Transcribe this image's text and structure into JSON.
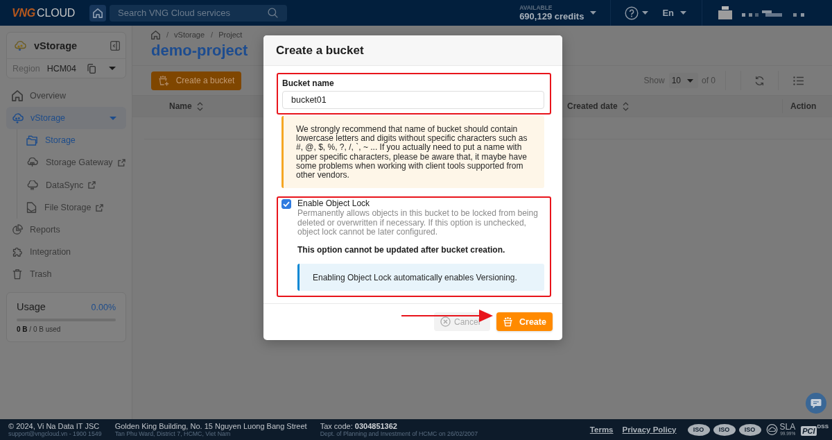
{
  "top_bar": {
    "logo": {
      "brand": "VNG",
      "product": "CLOUD"
    },
    "search": {
      "placeholder": "Search VNG Cloud services"
    },
    "credits": {
      "label": "AVAILABLE",
      "value": "690,129 credits"
    },
    "language": "En"
  },
  "sidebar": {
    "service": {
      "title": "vStorage"
    },
    "region": {
      "label": "Region",
      "value": "HCM04"
    },
    "items": [
      {
        "label": "Overview",
        "selected": false,
        "expanded": false
      },
      {
        "label": "vStorage",
        "selected": true,
        "expanded": true,
        "children": [
          {
            "label": "Storage",
            "selected": true,
            "external": false
          },
          {
            "label": "Storage Gateway",
            "selected": false,
            "external": true
          },
          {
            "label": "DataSync",
            "selected": false,
            "external": true
          },
          {
            "label": "File Storage",
            "selected": false,
            "external": true
          }
        ]
      },
      {
        "label": "Reports",
        "selected": false,
        "expanded": false
      },
      {
        "label": "Integration",
        "selected": false,
        "expanded": false
      },
      {
        "label": "Trash",
        "selected": false,
        "expanded": false
      }
    ],
    "usage": {
      "title": "Usage",
      "percent": "0.00%",
      "level": 0,
      "detail": "**0 B** / 0 B used"
    }
  },
  "page": {
    "breadcrumb": [
      "vStorage",
      "Project"
    ],
    "separator": "/",
    "title": "demo-project"
  },
  "toolbar": {
    "create_button": "Create a bucket",
    "show_label": "Show",
    "page_size": "10",
    "total": "of 0"
  },
  "table": {
    "columns": [
      {
        "label": "Name",
        "sortable": true
      },
      {
        "label": "Created date",
        "sortable": true
      },
      {
        "label": "Action",
        "sortable": false
      }
    ]
  },
  "dialog": {
    "title": "Create a bucket",
    "bucket_name": {
      "label": "Bucket name",
      "value": "bucket01",
      "highlighted": true
    },
    "warning": "We strongly recommend that name of bucket should contain lowercase letters and digits without specific characters such as #, @, $, %, ?, /, `, ~ ... If you actually need to put a name with upper specific characters, please be aware that, it maybe have some problems when working with client tools supported from other vendors.",
    "object_lock": {
      "label": "Enable Object Lock",
      "checked": true,
      "highlighted": true,
      "description": "Permanently allows objects in this bucket to be locked from being deleted or overwritten if necessary. If this option is unchecked, object lock cannot be later configured.",
      "note": "This option cannot be updated after bucket creation.",
      "info": "Enabling Object Lock automatically enables Versioning."
    },
    "pointer_arrow": true,
    "buttons": [
      {
        "label": "Cancel",
        "kind": "cancel",
        "disabled": true
      },
      {
        "label": "Create",
        "kind": "create",
        "disabled": false
      }
    ]
  },
  "footer": {
    "company": "© 2024, Vi Na Data IT JSC",
    "contact": "support@vngcloud.vn - 1900 1549",
    "address": "Golden King Building, No. 15 Nguyen Luong Bang Street",
    "address_line_2": "Tan Phu Ward, District 7, HCMC, Viet Nam",
    "tax": "Tax code: **0304851362**",
    "registration": "Dept. of Planning and Investment of HCMC on 26/02/2007",
    "links": [
      "Terms",
      "Privacy Policy"
    ],
    "badges": [
      {
        "kind": "iso",
        "label": "ISO"
      },
      {
        "kind": "iso",
        "label": "ISO"
      },
      {
        "kind": "iso",
        "label": "ISO"
      },
      {
        "kind": "sla",
        "label": "SLA",
        "value": "99.99%"
      },
      {
        "kind": "pci",
        "label": "PCI",
        "value": "DSS"
      }
    ]
  }
}
